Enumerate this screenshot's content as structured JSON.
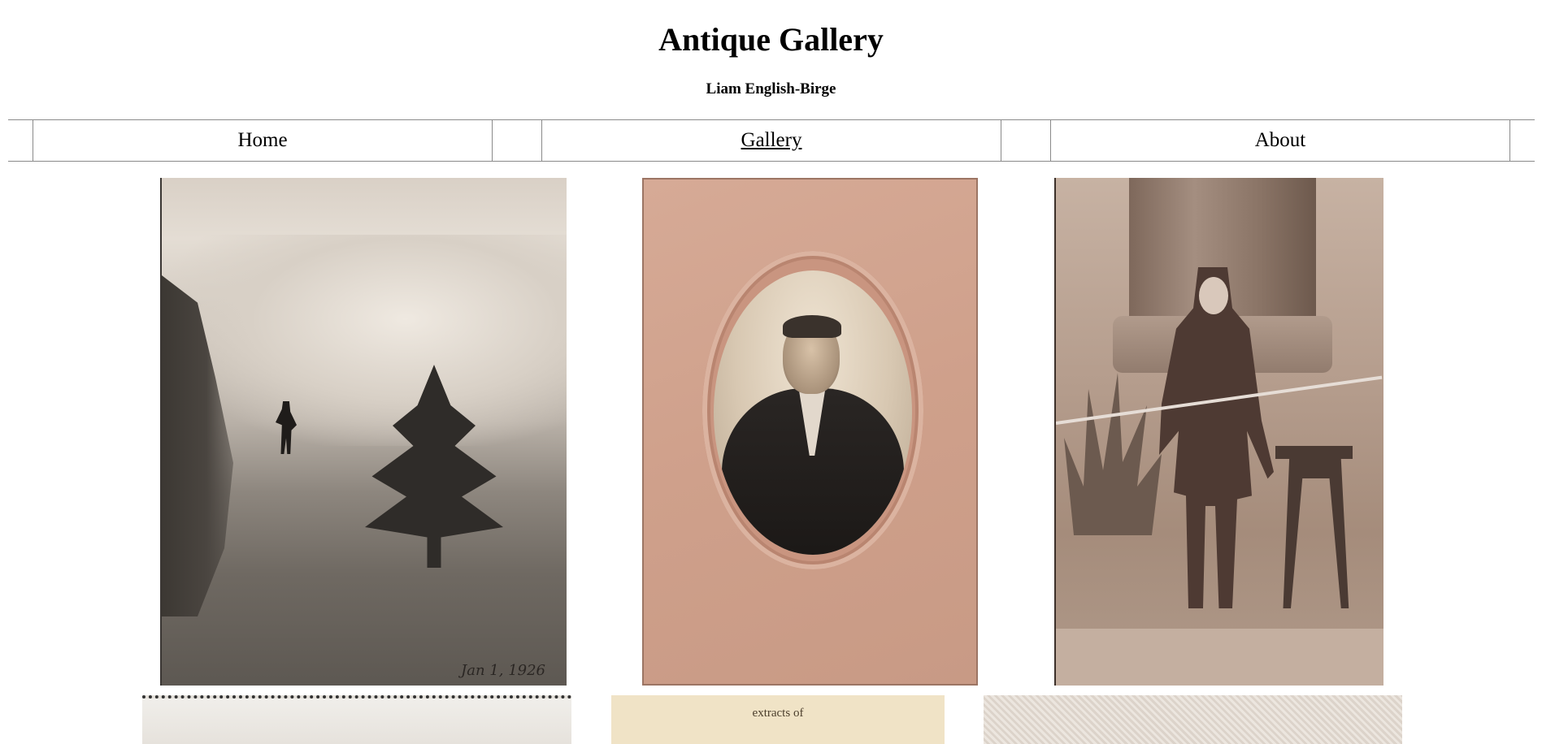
{
  "header": {
    "title": "Antique Gallery",
    "author": "Liam English-Birge"
  },
  "nav": {
    "items": [
      {
        "label": "Home"
      },
      {
        "label": "Gallery"
      },
      {
        "label": "About"
      }
    ],
    "active": "Gallery"
  },
  "gallery": {
    "photos": [
      {
        "subject": "snowy mountain slope with person and pine tree",
        "caption": "Jan 1, 1926"
      },
      {
        "subject": "cabinet card portrait of a man in oval mat"
      },
      {
        "subject": "cabinet card of a young girl by a column and stool"
      },
      {
        "subject": "partially visible photograph"
      },
      {
        "subject": "partially visible document",
        "caption": "extracts of"
      },
      {
        "subject": "partially visible embossed card"
      }
    ]
  }
}
